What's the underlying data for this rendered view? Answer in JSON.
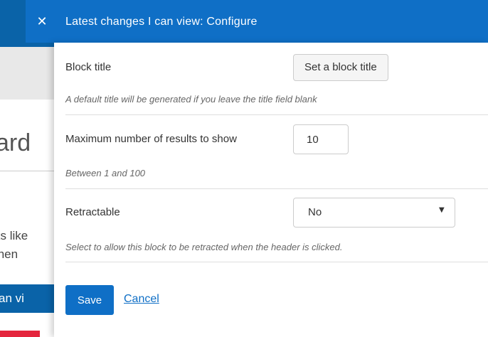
{
  "background": {
    "heading_fragment": "ard",
    "line_fragment_1": "ks like",
    "line_fragment_2": "then",
    "button_fragment": "an vi"
  },
  "modal": {
    "close_icon": "✕",
    "title": "Latest changes I can view: Configure",
    "fields": {
      "block_title": {
        "label": "Block title",
        "button_label": "Set a block title",
        "help": "A default title will be generated if you leave the title field blank"
      },
      "max_results": {
        "label": "Maximum number of results to show",
        "value": "10",
        "help": "Between 1 and 100"
      },
      "retractable": {
        "label": "Retractable",
        "selected": "No",
        "caret": "▼",
        "help": "Select to allow this block to be retracted when the header is clicked."
      }
    },
    "actions": {
      "save_label": "Save",
      "cancel_label": "Cancel"
    }
  },
  "colors": {
    "header_blue": "#0f6fc6",
    "primary_button": "#0f6fc6",
    "link": "#0f6fc6",
    "accent_red": "#e4253d"
  }
}
